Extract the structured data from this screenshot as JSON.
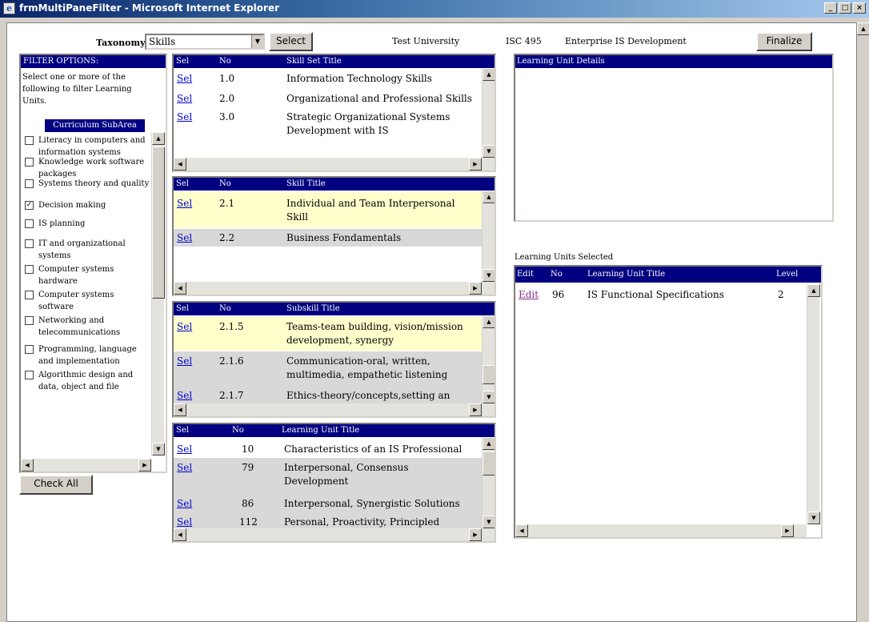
{
  "window": {
    "title": "frmMultiPaneFilter - Microsoft Internet Explorer",
    "minimize": "_",
    "restore": "□",
    "close": "×"
  },
  "toolbar": {
    "taxonomy_label": "Taxonomy:",
    "taxonomy_value": "Skills",
    "select_button": "Select",
    "university": "Test University",
    "course_code": "ISC 495",
    "course_name": "Enterprise IS Development",
    "finalize_button": "Finalize"
  },
  "filter": {
    "header": "FILTER OPTIONS:",
    "instructions": "Select one or more of the following to filter Learning Units.",
    "list_header": "Curriculum SubArea",
    "items": [
      {
        "label": "Literacy in computers and information systems",
        "checked": false
      },
      {
        "label": "Knowledge work software packages",
        "checked": false
      },
      {
        "label": "Systems theory and quality",
        "checked": false
      },
      {
        "label": "Decision making",
        "checked": true
      },
      {
        "label": "IS planning",
        "checked": false
      },
      {
        "label": "IT and organizational systems",
        "checked": false
      },
      {
        "label": "Computer systems hardware",
        "checked": false
      },
      {
        "label": "Computer systems software",
        "checked": false
      },
      {
        "label": "Networking and telecommunications",
        "checked": false
      },
      {
        "label": "Programming, language and implementation",
        "checked": false
      },
      {
        "label": "Algorithmic design and data, object and file",
        "checked": false
      }
    ],
    "check_all_button": "Check All"
  },
  "skill_set": {
    "headers": [
      "Sel",
      "No",
      "Skill Set Title"
    ],
    "rows": [
      {
        "sel": "Sel",
        "no": "1.0",
        "title": "Information Technology Skills"
      },
      {
        "sel": "Sel",
        "no": "2.0",
        "title": "Organizational and Professional Skills"
      },
      {
        "sel": "Sel",
        "no": "3.0",
        "title": "Strategic Organizational Systems Development with IS"
      }
    ]
  },
  "skill": {
    "headers": [
      "Sel",
      "No",
      "Skill Title"
    ],
    "rows": [
      {
        "sel": "Sel",
        "no": "2.1",
        "title": "Individual and Team Interpersonal Skill"
      },
      {
        "sel": "Sel",
        "no": "2.2",
        "title": "Business Fondamentals"
      }
    ]
  },
  "subskill": {
    "headers": [
      "Sel",
      "No",
      "Subskill Title"
    ],
    "rows": [
      {
        "sel": "Sel",
        "no": "2.1.5",
        "title": "Teams-team building, vision/mission development, synergy"
      },
      {
        "sel": "Sel",
        "no": "2.1.6",
        "title": "Communication-oral, written, multimedia, empathetic listening"
      },
      {
        "sel": "Sel",
        "no": "2.1.7",
        "title": "Ethics-theory/concepts,setting an"
      }
    ]
  },
  "learning_units": {
    "headers": [
      "Sel",
      "No",
      "Learning Unit Title"
    ],
    "rows": [
      {
        "sel": "Sel",
        "no": "10",
        "title": "Characteristics of an IS Professional"
      },
      {
        "sel": "Sel",
        "no": "79",
        "title": "Interpersonal, Consensus Development"
      },
      {
        "sel": "Sel",
        "no": "86",
        "title": "Interpersonal, Synergistic Solutions"
      },
      {
        "sel": "Sel",
        "no": "112",
        "title": "Personal, Proactivity, Principled"
      }
    ]
  },
  "details": {
    "header": "Learning Unit Details"
  },
  "selected": {
    "label": "Learning Units Selected",
    "headers": [
      "Edit",
      "No",
      "Learning Unit Title",
      "Level"
    ],
    "rows": [
      {
        "edit": "Edit",
        "no": "96",
        "title": "IS Functional Specifications",
        "level": "2"
      }
    ]
  }
}
